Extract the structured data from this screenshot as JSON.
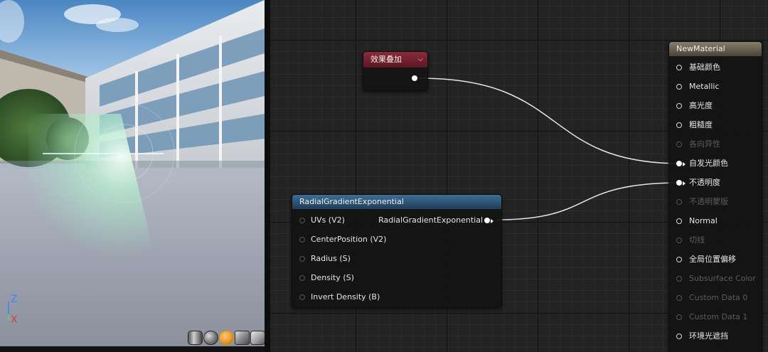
{
  "viewport": {
    "axis": {
      "z_label": "Z",
      "x_label": "X"
    },
    "preview_shapes": [
      {
        "icon": "cylinder-preview-icon",
        "active": false
      },
      {
        "icon": "sphere-preview-icon",
        "active": false
      },
      {
        "icon": "plane-preview-icon",
        "active": true
      },
      {
        "icon": "cube-preview-icon",
        "active": false
      },
      {
        "icon": "teapot-preview-icon",
        "active": false
      }
    ]
  },
  "graph": {
    "effect_node": {
      "title": "效果叠加",
      "chevron": "❯"
    },
    "radial_node": {
      "title": "RadialGradientExponential",
      "inputs": [
        "UVs (V2)",
        "CenterPosition (V2)",
        "Radius (S)",
        "Density (S)",
        "Invert Density (B)"
      ],
      "output": "RadialGradientExponential"
    },
    "material_node": {
      "title": "NewMaterial",
      "pins": [
        {
          "label": "基础颜色",
          "enabled": true,
          "connected": false
        },
        {
          "label": "Metallic",
          "enabled": true,
          "connected": false
        },
        {
          "label": "高光度",
          "enabled": true,
          "connected": false
        },
        {
          "label": "粗糙度",
          "enabled": true,
          "connected": false
        },
        {
          "label": "各向异性",
          "enabled": false,
          "connected": false
        },
        {
          "label": "自发光颜色",
          "enabled": true,
          "connected": true
        },
        {
          "label": "不透明度",
          "enabled": true,
          "connected": true
        },
        {
          "label": "不透明蒙版",
          "enabled": false,
          "connected": false
        },
        {
          "label": "Normal",
          "enabled": true,
          "connected": false
        },
        {
          "label": "切线",
          "enabled": false,
          "connected": false
        },
        {
          "label": "全局位置偏移",
          "enabled": true,
          "connected": false
        },
        {
          "label": "Subsurface Color",
          "enabled": false,
          "connected": false
        },
        {
          "label": "Custom Data 0",
          "enabled": false,
          "connected": false
        },
        {
          "label": "Custom Data 1",
          "enabled": false,
          "connected": false
        },
        {
          "label": "环境光遮挡",
          "enabled": true,
          "connected": false
        }
      ]
    }
  }
}
